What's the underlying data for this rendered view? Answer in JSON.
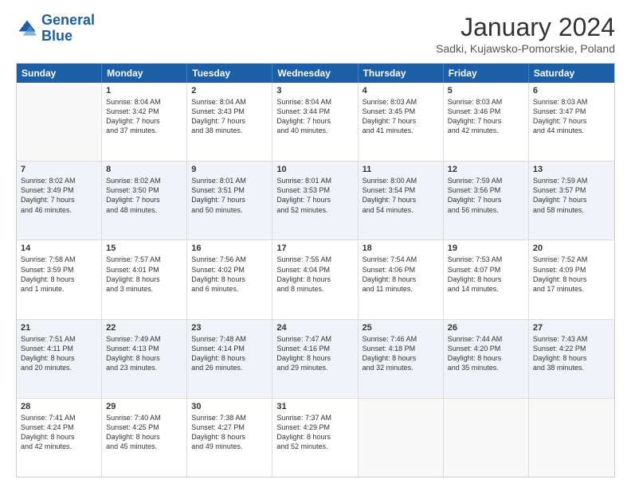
{
  "logo": {
    "line1": "General",
    "line2": "Blue"
  },
  "title": "January 2024",
  "subtitle": "Sadki, Kujawsko-Pomorskie, Poland",
  "headers": [
    "Sunday",
    "Monday",
    "Tuesday",
    "Wednesday",
    "Thursday",
    "Friday",
    "Saturday"
  ],
  "rows": [
    [
      {
        "day": "",
        "lines": []
      },
      {
        "day": "1",
        "lines": [
          "Sunrise: 8:04 AM",
          "Sunset: 3:42 PM",
          "Daylight: 7 hours",
          "and 37 minutes."
        ]
      },
      {
        "day": "2",
        "lines": [
          "Sunrise: 8:04 AM",
          "Sunset: 3:43 PM",
          "Daylight: 7 hours",
          "and 38 minutes."
        ]
      },
      {
        "day": "3",
        "lines": [
          "Sunrise: 8:04 AM",
          "Sunset: 3:44 PM",
          "Daylight: 7 hours",
          "and 40 minutes."
        ]
      },
      {
        "day": "4",
        "lines": [
          "Sunrise: 8:03 AM",
          "Sunset: 3:45 PM",
          "Daylight: 7 hours",
          "and 41 minutes."
        ]
      },
      {
        "day": "5",
        "lines": [
          "Sunrise: 8:03 AM",
          "Sunset: 3:46 PM",
          "Daylight: 7 hours",
          "and 42 minutes."
        ]
      },
      {
        "day": "6",
        "lines": [
          "Sunrise: 8:03 AM",
          "Sunset: 3:47 PM",
          "Daylight: 7 hours",
          "and 44 minutes."
        ]
      }
    ],
    [
      {
        "day": "7",
        "lines": [
          "Sunrise: 8:02 AM",
          "Sunset: 3:49 PM",
          "Daylight: 7 hours",
          "and 46 minutes."
        ]
      },
      {
        "day": "8",
        "lines": [
          "Sunrise: 8:02 AM",
          "Sunset: 3:50 PM",
          "Daylight: 7 hours",
          "and 48 minutes."
        ]
      },
      {
        "day": "9",
        "lines": [
          "Sunrise: 8:01 AM",
          "Sunset: 3:51 PM",
          "Daylight: 7 hours",
          "and 50 minutes."
        ]
      },
      {
        "day": "10",
        "lines": [
          "Sunrise: 8:01 AM",
          "Sunset: 3:53 PM",
          "Daylight: 7 hours",
          "and 52 minutes."
        ]
      },
      {
        "day": "11",
        "lines": [
          "Sunrise: 8:00 AM",
          "Sunset: 3:54 PM",
          "Daylight: 7 hours",
          "and 54 minutes."
        ]
      },
      {
        "day": "12",
        "lines": [
          "Sunrise: 7:59 AM",
          "Sunset: 3:56 PM",
          "Daylight: 7 hours",
          "and 56 minutes."
        ]
      },
      {
        "day": "13",
        "lines": [
          "Sunrise: 7:59 AM",
          "Sunset: 3:57 PM",
          "Daylight: 7 hours",
          "and 58 minutes."
        ]
      }
    ],
    [
      {
        "day": "14",
        "lines": [
          "Sunrise: 7:58 AM",
          "Sunset: 3:59 PM",
          "Daylight: 8 hours",
          "and 1 minute."
        ]
      },
      {
        "day": "15",
        "lines": [
          "Sunrise: 7:57 AM",
          "Sunset: 4:01 PM",
          "Daylight: 8 hours",
          "and 3 minutes."
        ]
      },
      {
        "day": "16",
        "lines": [
          "Sunrise: 7:56 AM",
          "Sunset: 4:02 PM",
          "Daylight: 8 hours",
          "and 6 minutes."
        ]
      },
      {
        "day": "17",
        "lines": [
          "Sunrise: 7:55 AM",
          "Sunset: 4:04 PM",
          "Daylight: 8 hours",
          "and 8 minutes."
        ]
      },
      {
        "day": "18",
        "lines": [
          "Sunrise: 7:54 AM",
          "Sunset: 4:06 PM",
          "Daylight: 8 hours",
          "and 11 minutes."
        ]
      },
      {
        "day": "19",
        "lines": [
          "Sunrise: 7:53 AM",
          "Sunset: 4:07 PM",
          "Daylight: 8 hours",
          "and 14 minutes."
        ]
      },
      {
        "day": "20",
        "lines": [
          "Sunrise: 7:52 AM",
          "Sunset: 4:09 PM",
          "Daylight: 8 hours",
          "and 17 minutes."
        ]
      }
    ],
    [
      {
        "day": "21",
        "lines": [
          "Sunrise: 7:51 AM",
          "Sunset: 4:11 PM",
          "Daylight: 8 hours",
          "and 20 minutes."
        ]
      },
      {
        "day": "22",
        "lines": [
          "Sunrise: 7:49 AM",
          "Sunset: 4:13 PM",
          "Daylight: 8 hours",
          "and 23 minutes."
        ]
      },
      {
        "day": "23",
        "lines": [
          "Sunrise: 7:48 AM",
          "Sunset: 4:14 PM",
          "Daylight: 8 hours",
          "and 26 minutes."
        ]
      },
      {
        "day": "24",
        "lines": [
          "Sunrise: 7:47 AM",
          "Sunset: 4:16 PM",
          "Daylight: 8 hours",
          "and 29 minutes."
        ]
      },
      {
        "day": "25",
        "lines": [
          "Sunrise: 7:46 AM",
          "Sunset: 4:18 PM",
          "Daylight: 8 hours",
          "and 32 minutes."
        ]
      },
      {
        "day": "26",
        "lines": [
          "Sunrise: 7:44 AM",
          "Sunset: 4:20 PM",
          "Daylight: 8 hours",
          "and 35 minutes."
        ]
      },
      {
        "day": "27",
        "lines": [
          "Sunrise: 7:43 AM",
          "Sunset: 4:22 PM",
          "Daylight: 8 hours",
          "and 38 minutes."
        ]
      }
    ],
    [
      {
        "day": "28",
        "lines": [
          "Sunrise: 7:41 AM",
          "Sunset: 4:24 PM",
          "Daylight: 8 hours",
          "and 42 minutes."
        ]
      },
      {
        "day": "29",
        "lines": [
          "Sunrise: 7:40 AM",
          "Sunset: 4:25 PM",
          "Daylight: 8 hours",
          "and 45 minutes."
        ]
      },
      {
        "day": "30",
        "lines": [
          "Sunrise: 7:38 AM",
          "Sunset: 4:27 PM",
          "Daylight: 8 hours",
          "and 49 minutes."
        ]
      },
      {
        "day": "31",
        "lines": [
          "Sunrise: 7:37 AM",
          "Sunset: 4:29 PM",
          "Daylight: 8 hours",
          "and 52 minutes."
        ]
      },
      {
        "day": "",
        "lines": []
      },
      {
        "day": "",
        "lines": []
      },
      {
        "day": "",
        "lines": []
      }
    ]
  ]
}
